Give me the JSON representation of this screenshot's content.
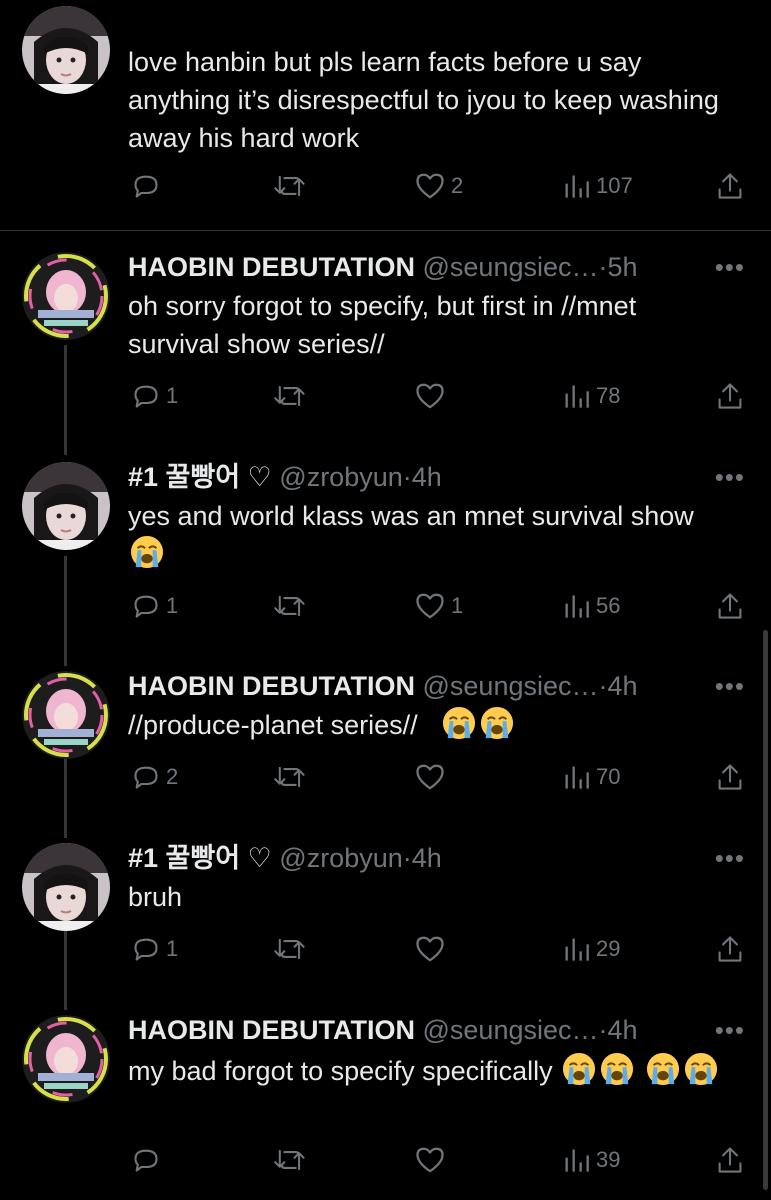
{
  "tweets": [
    {
      "id": "t0",
      "name": "",
      "handle": "",
      "time": "",
      "text": "love hanbin but pls learn facts before u say anything it’s disrespectful to jyou to keep washing away his hard work",
      "replies": "",
      "likes": "2",
      "views": "107",
      "avatar": "girl"
    },
    {
      "id": "t1",
      "name": "HAOBIN DEBUTATION",
      "handle": "@seungsiec…",
      "time": "5h",
      "text": "oh sorry forgot to specify, but first in //mnet survival show series//",
      "replies": "1",
      "likes": "",
      "views": "78",
      "avatar": "pink"
    },
    {
      "id": "t2",
      "name": "#1 꿀빵어 ♡",
      "handle": "@zrobyun",
      "time": "4h",
      "text": "yes and world klass was an mnet survival show",
      "emoji_count": 1,
      "replies": "1",
      "likes": "1",
      "views": "56",
      "avatar": "girl"
    },
    {
      "id": "t3",
      "name": "HAOBIN DEBUTATION",
      "handle": "@seungsiec…",
      "time": "4h",
      "text": "//produce-planet series//",
      "emoji_count": 2,
      "replies": "2",
      "likes": "",
      "views": "70",
      "avatar": "pink"
    },
    {
      "id": "t4",
      "name": "#1 꿀빵어 ♡",
      "handle": "@zrobyun",
      "time": "4h",
      "text": "bruh",
      "replies": "1",
      "likes": "",
      "views": "29",
      "avatar": "girl"
    },
    {
      "id": "t5",
      "name": "HAOBIN DEBUTATION",
      "handle": "@seungsiec…",
      "time": "4h",
      "text": "my bad forgot to specify specifically",
      "emoji_count": 4,
      "replies": "",
      "likes": "",
      "views": "39",
      "avatar": "pink"
    }
  ],
  "icons": {
    "reply": "reply-icon",
    "retweet": "retweet-icon",
    "like": "heart-icon",
    "views": "views-icon",
    "share": "share-icon",
    "more": "more-icon",
    "emoji": "loudly-crying-face-emoji"
  },
  "colors": {
    "background": "#000000",
    "text": "#e7e9ea",
    "muted": "#71767b",
    "thread_line": "#333639"
  },
  "dot": "·",
  "more_glyph": "•••"
}
